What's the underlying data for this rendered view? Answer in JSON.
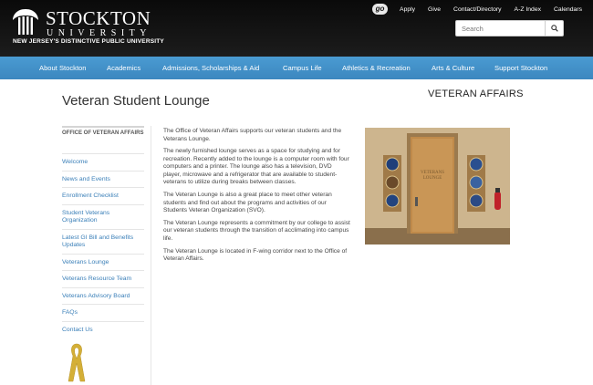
{
  "header": {
    "logo_name": "STOCKTON",
    "logo_university": "UNIVERSITY",
    "logo_tagline": "NEW JERSEY'S DISTINCTIVE PUBLIC UNIVERSITY",
    "go_badge": "go",
    "utility_links": [
      "Apply",
      "Give",
      "Contact/Directory",
      "A-Z Index",
      "Calendars"
    ],
    "search_placeholder": "Search"
  },
  "main_nav": [
    "About Stockton",
    "Academics",
    "Admissions, Scholarships & Aid",
    "Campus Life",
    "Athletics & Recreation",
    "Arts & Culture",
    "Support Stockton"
  ],
  "page": {
    "title": "Veteran Student Lounge",
    "section_title": "VETERAN AFFAIRS"
  },
  "sidebar": {
    "heading": "OFFICE OF VETERAN AFFAIRS",
    "items": [
      "Welcome",
      "News and Events",
      "Enrollment Checklist",
      "Student Veterans Organization",
      "Latest GI Bill and Benefits Updates",
      "Veterans Lounge",
      "Veterans Resource Team",
      "Veterans Advisory Board",
      "FAQs",
      "Contact Us"
    ]
  },
  "content": {
    "paragraphs": [
      "The Office of Veteran Affairs supports our veteran students and the Veterans Lounge.",
      "The newly furnished lounge serves as a space for studying and for recreation. Recently added to the lounge is a computer room with four computers and a printer. The lounge also has a television, DVD player, microwave and a refrigerator that are available to student-veterans to utilize during breaks between classes.",
      "The Veteran Lounge is also a great place to meet other veteran students and find out about the programs and activities of our Students Veteran Organization (SVO).",
      "The Veteran Lounge represents a commitment by our college to assist our veteran students through the transition of acclimating into campus life.",
      "The Veteran Lounge is located in F-wing corridor next to the Office of Veteran Affairs."
    ],
    "photo_sign": "VETERANS LOUNGE"
  },
  "colors": {
    "header_bg": "#111111",
    "nav_bg": "#428fc8",
    "link": "#3a7fb8",
    "ribbon": "#d4af37"
  }
}
